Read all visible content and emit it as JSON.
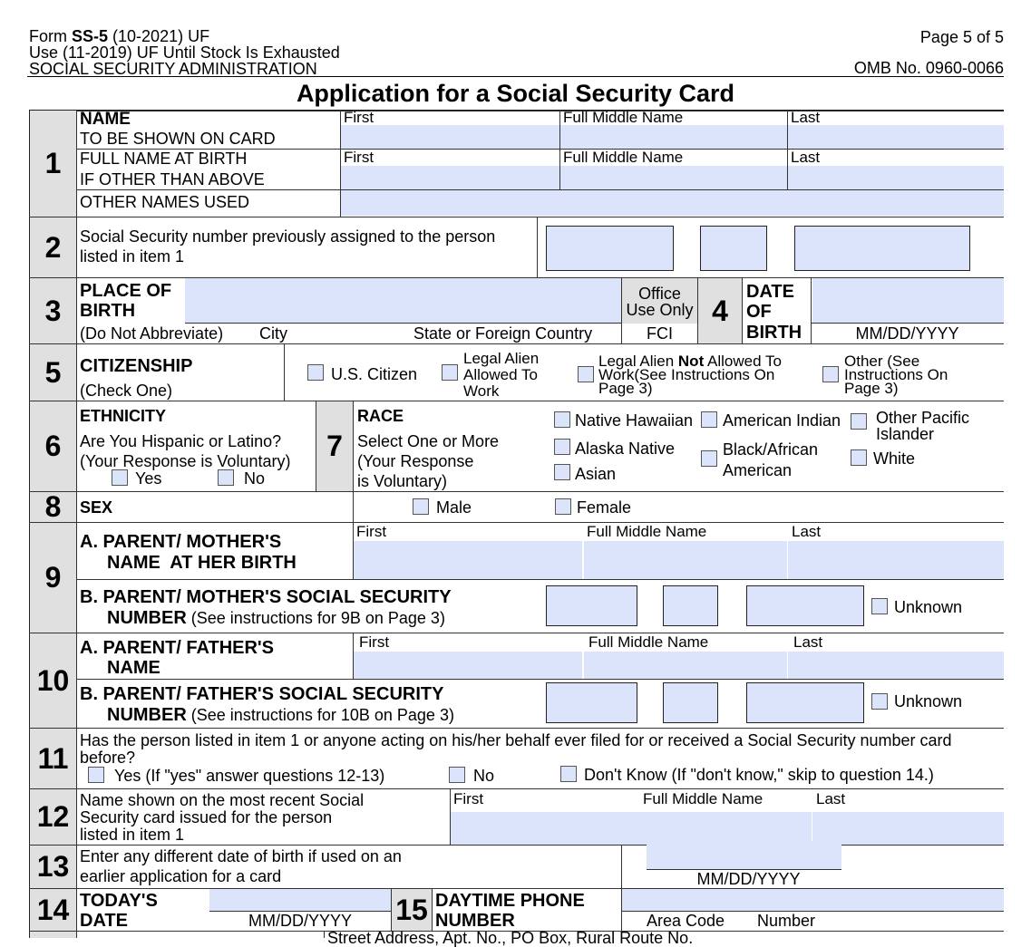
{
  "header": {
    "form_prefix": "Form ",
    "form_id": "SS-5",
    "form_version": " (10-2021) UF",
    "use_line": "Use (11-2019) UF Until Stock Is Exhausted",
    "agency": "SOCIAL SECURITY ADMINISTRATION",
    "page": "Page 5 of 5",
    "omb": "OMB No. 0960-0066",
    "title": "Application for a Social Security Card"
  },
  "colors": {
    "field_fill": "#dce4fb",
    "section_gray": "#e0e0e0"
  },
  "name_columns": {
    "first": "First",
    "middle": "Full Middle Name",
    "last": "Last"
  },
  "item1": {
    "number": "1",
    "name_label": "NAME",
    "name_sub": "TO BE SHOWN ON CARD",
    "birth_label1": "FULL NAME AT BIRTH",
    "birth_label2": "IF OTHER THAN ABOVE",
    "other_label": "OTHER NAMES USED"
  },
  "item2": {
    "number": "2",
    "line1": "Social Security number previously assigned to the person",
    "line2": "listed in item 1"
  },
  "item3": {
    "number": "3",
    "label1": "PLACE OF",
    "label2": "BIRTH",
    "note": "(Do Not Abbreviate)",
    "city": "City",
    "state": "State or Foreign Country",
    "office1": "Office",
    "office2": "Use Only",
    "fci": "FCI"
  },
  "item4": {
    "number": "4",
    "label1": "DATE",
    "label2": "OF",
    "label3": "BIRTH",
    "format": "MM/DD/YYYY"
  },
  "item5": {
    "number": "5",
    "label": "CITIZENSHIP",
    "sub": "(Check One)",
    "opt_us": "U.S. Citizen",
    "opt_legal1": "Legal Alien",
    "opt_legal2": "Allowed To",
    "opt_legal3": "Work",
    "opt_not1_a": "Legal Alien ",
    "opt_not1_b": "Not",
    "opt_not1_c": " Allowed To",
    "opt_not2": "Work(See Instructions On",
    "opt_not3": "Page 3)",
    "opt_other1": "Other (See",
    "opt_other2": "Instructions On",
    "opt_other3": "Page 3)"
  },
  "item6": {
    "number": "6",
    "label": "ETHNICITY",
    "q": "Are You Hispanic or Latino?",
    "voluntary": "(Your Response is Voluntary)",
    "yes": "Yes",
    "no": "No"
  },
  "item7": {
    "number": "7",
    "label": "RACE",
    "sub1": "Select One or More",
    "sub2": "(Your Response",
    "sub3": "is Voluntary)",
    "native_hawaiian": "Native Hawaiian",
    "american_indian": "American Indian",
    "other_pacific1": "Other Pacific",
    "other_pacific2": "Islander",
    "alaska_native": "Alaska Native",
    "black1": "Black/African",
    "black2": "American",
    "white": "White",
    "asian": "Asian"
  },
  "item8": {
    "number": "8",
    "label": "SEX",
    "male": "Male",
    "female": "Female"
  },
  "item9": {
    "number": "9",
    "a1": "A. PARENT/ MOTHER'S",
    "a2": "NAME  AT HER BIRTH",
    "b1": "B. PARENT/ MOTHER'S SOCIAL SECURITY",
    "b2_bold": "NUMBER",
    "b2_rest": " (See instructions for 9B on Page 3)",
    "unknown": "Unknown"
  },
  "item10": {
    "number": "10",
    "a1": "A. PARENT/ FATHER'S",
    "a2": "NAME",
    "b1": "B. PARENT/ FATHER'S SOCIAL SECURITY",
    "b2_bold": "NUMBER",
    "b2_rest": " (See instructions for 10B on Page 3)",
    "unknown": "Unknown"
  },
  "item11": {
    "number": "11",
    "q1": "Has the person listed in item 1 or anyone acting on his/her behalf ever filed for or received a Social Security number card",
    "q2": "before?",
    "yes": "Yes (If \"yes\" answer questions 12-13)",
    "no": "No",
    "dont_know": "Don't Know (If \"don't know,\" skip to question 14.)"
  },
  "item12": {
    "number": "12",
    "l1": "Name shown on the most recent Social",
    "l2": "Security card issued for the person",
    "l3": "listed in item 1"
  },
  "item13": {
    "number": "13",
    "l1": "Enter any different date of birth if used on an",
    "l2": "earlier application for a card",
    "format": "MM/DD/YYYY"
  },
  "item14": {
    "number": "14",
    "l1": "TODAY'S",
    "l2": "DATE",
    "format": "MM/DD/YYYY"
  },
  "item15": {
    "number": "15",
    "l1": "DAYTIME PHONE",
    "l2": "NUMBER",
    "area": "Area Code",
    "phone_number": "Number"
  },
  "item16": {
    "street": "Street Address, Apt. No., PO Box, Rural Route No."
  }
}
